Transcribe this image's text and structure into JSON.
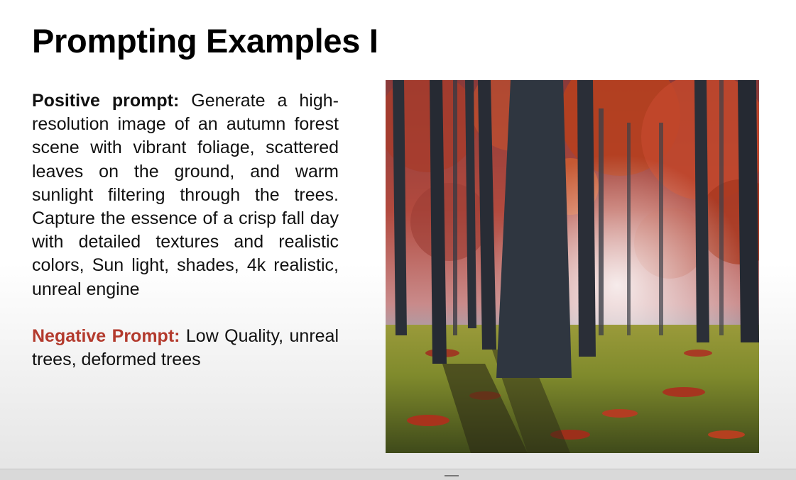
{
  "slide": {
    "title": "Prompting Examples I",
    "positive": {
      "label": "Positive prompt:",
      "text": " Generate a high-resolution image of an autumn forest scene with vibrant foliage, scattered leaves on the ground, and warm sunlight filtering through the trees. Capture the essence of a crisp fall day with detailed textures and realistic colors, Sun light, shades, 4k realistic, unreal engine"
    },
    "negative": {
      "label": "Negative Prompt:",
      "text": " Low Quality, unreal trees, deformed trees"
    }
  },
  "colors": {
    "negative_label": "#b33a2d",
    "title": "#000000"
  }
}
